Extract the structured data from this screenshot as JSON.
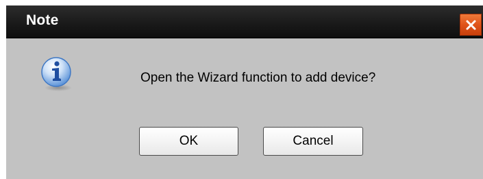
{
  "dialog": {
    "title": "Note",
    "message": "Open the Wizard function to add device?",
    "icon": "info-icon",
    "buttons": {
      "ok_label": "OK",
      "cancel_label": "Cancel"
    },
    "close_icon": "close-icon"
  },
  "colors": {
    "titlebar": "#1a1a1a",
    "body": "#c2c2c2",
    "close_button": "#e0541a",
    "icon_blue": "#2f6fc8"
  }
}
